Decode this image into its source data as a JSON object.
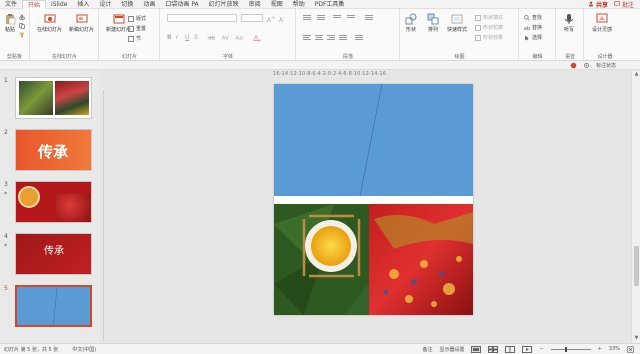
{
  "menu": {
    "tabs": [
      "文件",
      "开始",
      "iSlide",
      "插入",
      "设计",
      "切换",
      "动画",
      "口袋动画 PA",
      "幻灯片放映",
      "审阅",
      "视图",
      "帮助",
      "PDF工具集"
    ],
    "active": "开始",
    "share": "共享",
    "comment": "批注"
  },
  "ribbon": {
    "clipboard": {
      "label": "剪贴板",
      "paste": "粘贴"
    },
    "online": {
      "label": "在线幻灯片",
      "online_btn": "在线幻灯片",
      "new_btn": "新稿幻灯片"
    },
    "slides": {
      "label": "幻灯片",
      "new_slide": "新建幻灯片",
      "layout": "版式",
      "reset": "重置",
      "section": "节"
    },
    "font": {
      "label": "字体",
      "bold": "B",
      "italic": "I",
      "underline": "U",
      "strike": "S"
    },
    "paragraph": {
      "label": "段落"
    },
    "drawing": {
      "label": "绘图",
      "shapes": "形状",
      "arrange": "排列",
      "quick_styles": "快速样式",
      "fill": "形状填充",
      "outline": "形状轮廓",
      "effects": "形状效果"
    },
    "editing": {
      "label": "编辑",
      "find": "查找",
      "replace": "替换",
      "select": "选择"
    },
    "voice": {
      "label": "语音",
      "dictate": "听写"
    },
    "designer": {
      "label": "设计器",
      "design_ideas": "设计灵感"
    }
  },
  "toolbar2": {
    "mark_status": "标注状态"
  },
  "thumbnails": [
    {
      "num": "1",
      "star": ""
    },
    {
      "num": "2",
      "star": "",
      "text": "传承"
    },
    {
      "num": "3",
      "star": "*"
    },
    {
      "num": "4",
      "star": "*",
      "text": "传承"
    },
    {
      "num": "5",
      "star": ""
    }
  ],
  "ruler": {
    "h": "16·14·12·10·8·6·4·2·0·2·4·6·8·10·12·14·16"
  },
  "status": {
    "slide_info": "幻灯片 第 5 张，共 5 张",
    "language": "中文(中国)",
    "notes": "备注",
    "display_settings": "显示器设置",
    "zoom": "33%"
  },
  "colors": {
    "accent": "#d24726",
    "slide_blue": "#5b9bd5"
  }
}
